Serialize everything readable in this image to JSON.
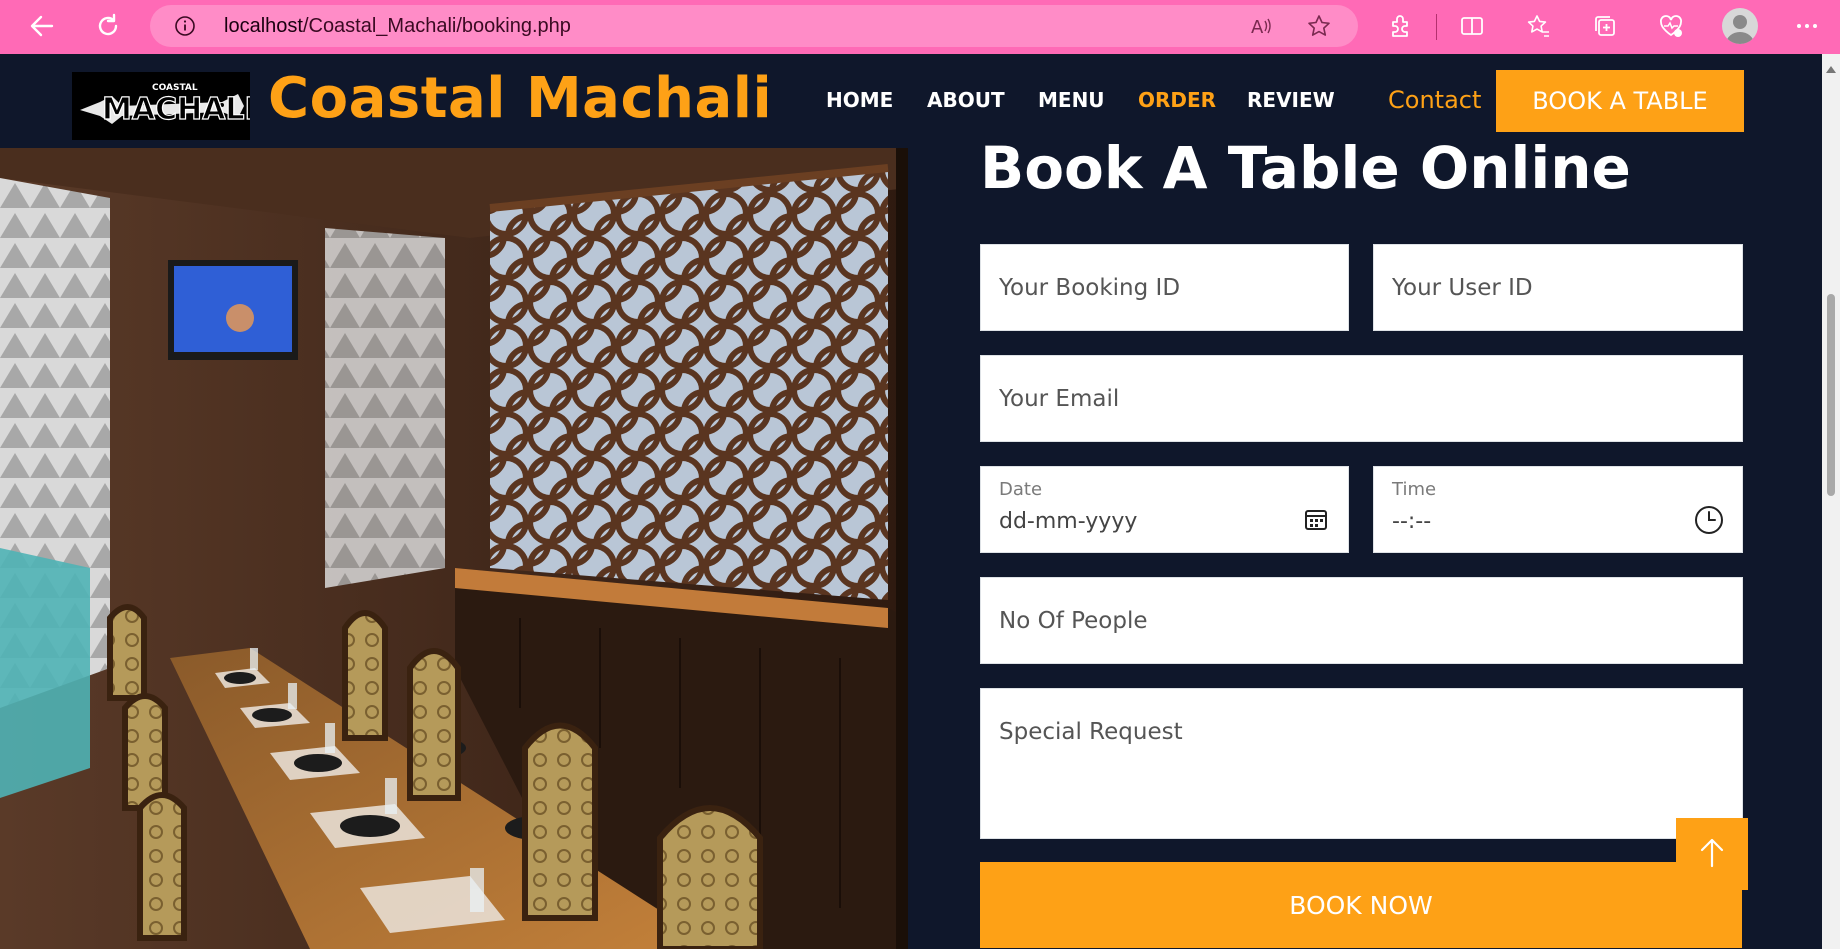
{
  "browser": {
    "url_host": "localhost",
    "url_path": "/Coastal_Machali/booking.php",
    "icons": [
      "back-icon",
      "refresh-icon",
      "info-icon",
      "read-aloud-icon",
      "favorite-star-icon",
      "extensions-icon",
      "split-screen-icon",
      "favorites-icon",
      "collections-icon",
      "health-icon",
      "profile-avatar",
      "more-icon"
    ]
  },
  "header": {
    "logo_text_top": "COASTAL",
    "logo_text_main": "MACHALI",
    "brand": "Coastal Machali",
    "nav": [
      {
        "label": "HOME"
      },
      {
        "label": "ABOUT"
      },
      {
        "label": "MENU"
      },
      {
        "label": "ORDER",
        "active": true
      },
      {
        "label": "REVIEW"
      }
    ],
    "contact": "Contact",
    "book_table": "BOOK A TABLE"
  },
  "form": {
    "title": "Book A Table Online",
    "booking_id_placeholder": "Your Booking ID",
    "user_id_placeholder": "Your User ID",
    "email_placeholder": "Your Email",
    "date_label": "Date",
    "date_value": "dd-mm-yyyy",
    "time_label": "Time",
    "time_value": "--:--",
    "people_placeholder": "No Of People",
    "request_placeholder": "Special Request",
    "submit": "BOOK NOW"
  },
  "colors": {
    "accent": "#fea116",
    "dark_bg": "#0f172b",
    "browser_bar": "#ff6ab6"
  }
}
